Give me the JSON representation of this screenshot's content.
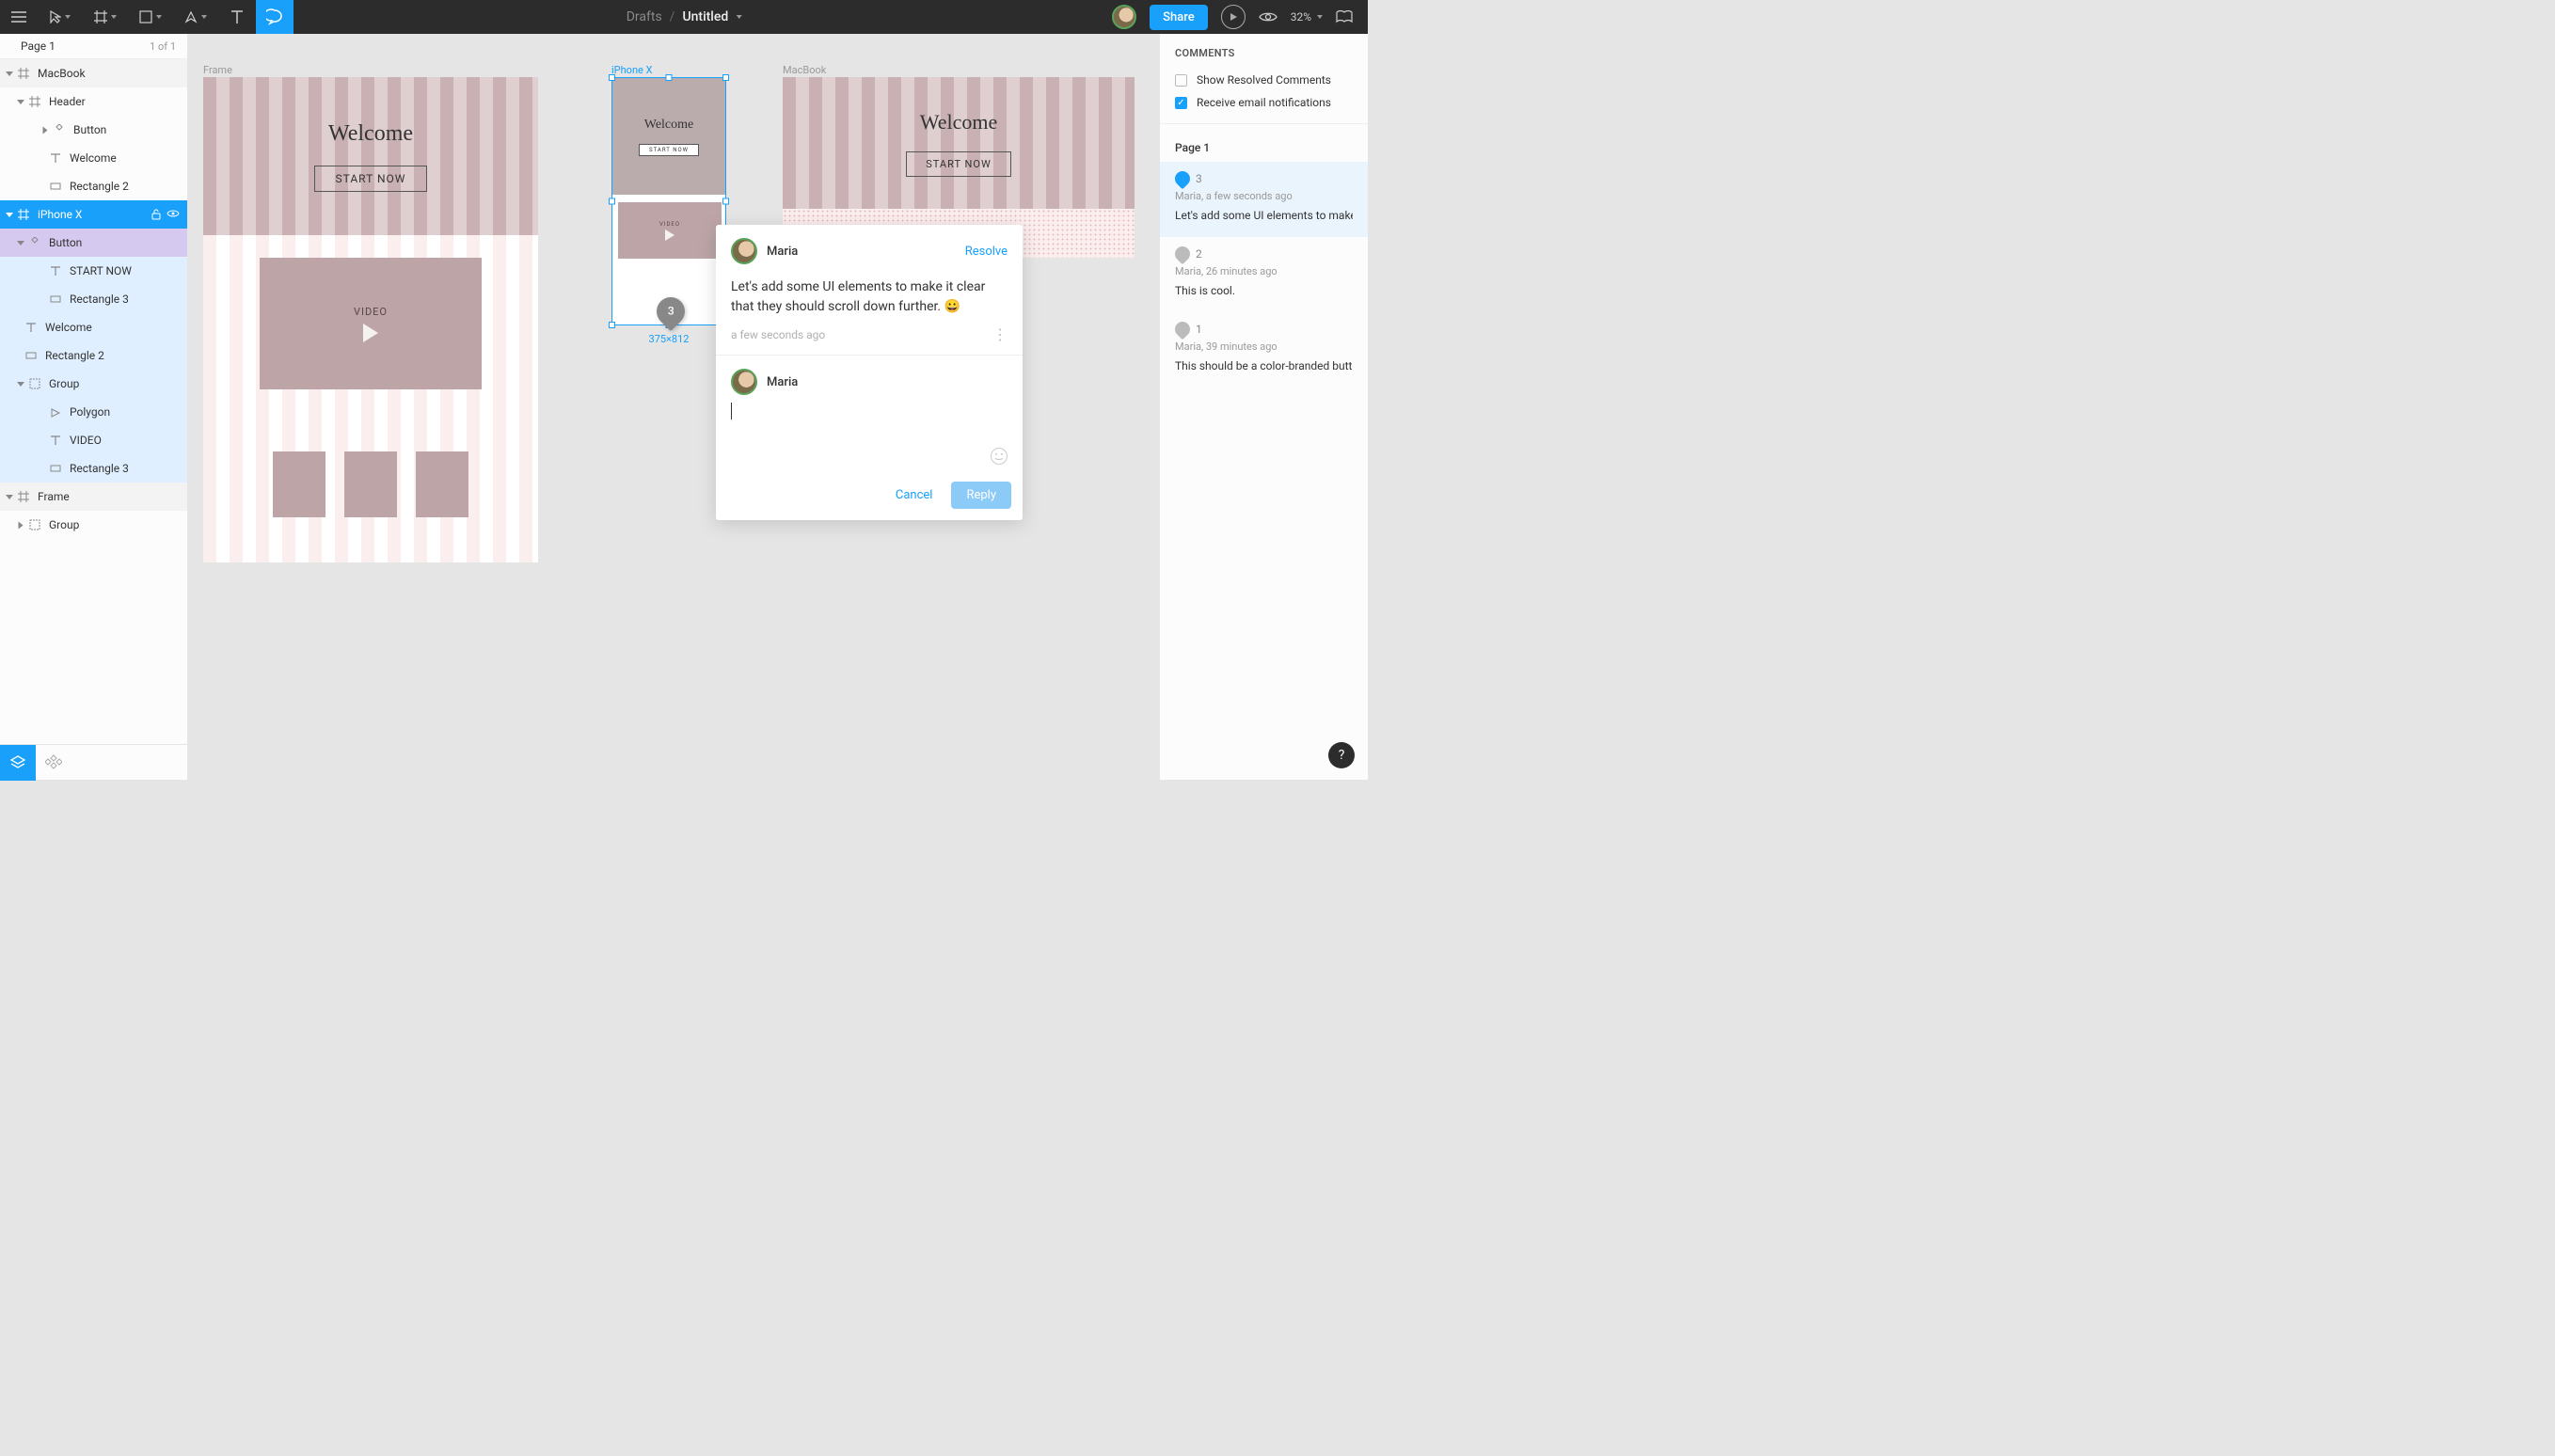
{
  "toolbar": {
    "drafts_label": "Drafts",
    "doc_title": "Untitled",
    "share_label": "Share",
    "zoom_label": "32%"
  },
  "pages": {
    "current": "Page 1",
    "count": "1 of 1"
  },
  "layers": [
    {
      "depth": 0,
      "type": "frame",
      "label": "MacBook",
      "expand": "open"
    },
    {
      "depth": 1,
      "type": "frame",
      "label": "Header",
      "expand": "open"
    },
    {
      "depth": 2,
      "type": "component",
      "label": "Button",
      "expand": "closed"
    },
    {
      "depth": 2,
      "type": "text",
      "label": "Welcome"
    },
    {
      "depth": 2,
      "type": "rect",
      "label": "Rectangle 2"
    },
    {
      "depth": 0,
      "type": "frame",
      "label": "iPhone X",
      "expand": "open",
      "selected": true
    },
    {
      "depth": 1,
      "type": "component",
      "label": "Button",
      "expand": "open",
      "child_sel": true
    },
    {
      "depth": 2,
      "type": "text",
      "label": "START NOW",
      "in_sel": true
    },
    {
      "depth": 2,
      "type": "rect",
      "label": "Rectangle 3",
      "in_sel": true
    },
    {
      "depth": 1,
      "type": "text",
      "label": "Welcome",
      "in_sel": true
    },
    {
      "depth": 1,
      "type": "rect",
      "label": "Rectangle 2",
      "in_sel": true
    },
    {
      "depth": 1,
      "type": "group",
      "label": "Group",
      "expand": "open",
      "in_sel": true
    },
    {
      "depth": 2,
      "type": "polygon",
      "label": "Polygon",
      "in_sel": true
    },
    {
      "depth": 2,
      "type": "text",
      "label": "VIDEO",
      "in_sel": true
    },
    {
      "depth": 2,
      "type": "rect",
      "label": "Rectangle 3",
      "in_sel": true
    },
    {
      "depth": 0,
      "type": "frame",
      "label": "Frame",
      "expand": "open"
    },
    {
      "depth": 1,
      "type": "group",
      "label": "Group",
      "expand": "closed"
    }
  ],
  "canvas": {
    "frames": {
      "macbook": {
        "label": "Frame",
        "welcome": "Welcome",
        "cta": "START NOW",
        "video": "VIDEO"
      },
      "iphone": {
        "label": "iPhone X",
        "welcome": "Welcome",
        "cta": "START NOW",
        "video": "VIDEO",
        "dims": "375×812"
      },
      "macbook2": {
        "label": "MacBook",
        "welcome": "Welcome",
        "cta": "START NOW"
      }
    },
    "comment_pin": "3"
  },
  "comment_popover": {
    "author": "Maria",
    "resolve": "Resolve",
    "body": "Let's add some UI elements to make it clear that they should scroll down further. 😀",
    "time": "a few seconds ago",
    "reply_author": "Maria",
    "cancel": "Cancel",
    "reply": "Reply"
  },
  "right_panel": {
    "title": "COMMENTS",
    "show_resolved": "Show Resolved Comments",
    "email_notif": "Receive email notifications",
    "page_label": "Page 1",
    "comments": [
      {
        "n": "3",
        "active": true,
        "meta": "Maria, a few seconds ago",
        "text": "Let's add some UI elements to make it"
      },
      {
        "n": "2",
        "active": false,
        "meta": "Maria, 26 minutes ago",
        "text": "This is cool."
      },
      {
        "n": "1",
        "active": false,
        "meta": "Maria, 39 minutes ago",
        "text": "This should be a color-branded button"
      }
    ]
  },
  "help": "?"
}
